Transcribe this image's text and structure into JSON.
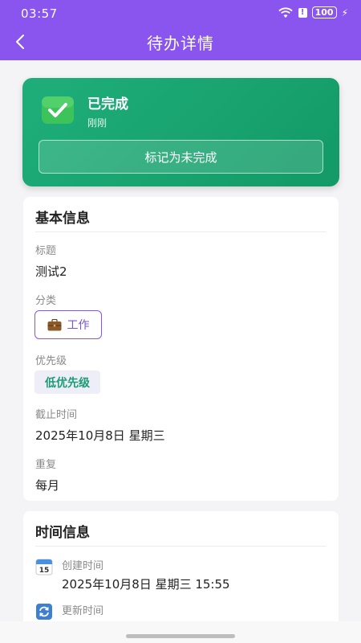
{
  "status_bar": {
    "time": "03:57",
    "battery": "100"
  },
  "app_bar": {
    "title": "待办详情",
    "back_icon": "chevron-left-icon"
  },
  "status_card": {
    "status": "已完成",
    "completed_time": "刚刚",
    "toggle_button": "标记为未完成",
    "icon": "check-icon",
    "color": "#1aa673"
  },
  "basic_info": {
    "section_title": "基本信息",
    "title_label": "标题",
    "title_value": "测试2",
    "category_label": "分类",
    "category_value": "工作",
    "category_icon": "briefcase-icon",
    "priority_label": "优先级",
    "priority_value": "低优先级",
    "deadline_label": "截止时间",
    "deadline_value": "2025年10月8日 星期三",
    "repeat_label": "重复",
    "repeat_value": "每月"
  },
  "time_info": {
    "section_title": "时间信息",
    "created_label": "创建时间",
    "created_value": "2025年10月8日 星期三 15:55",
    "created_icon_day": "15",
    "updated_label": "更新时间"
  },
  "colors": {
    "header": "#8a55ee",
    "accent": "#8a55ee",
    "success": "#1aa673"
  }
}
